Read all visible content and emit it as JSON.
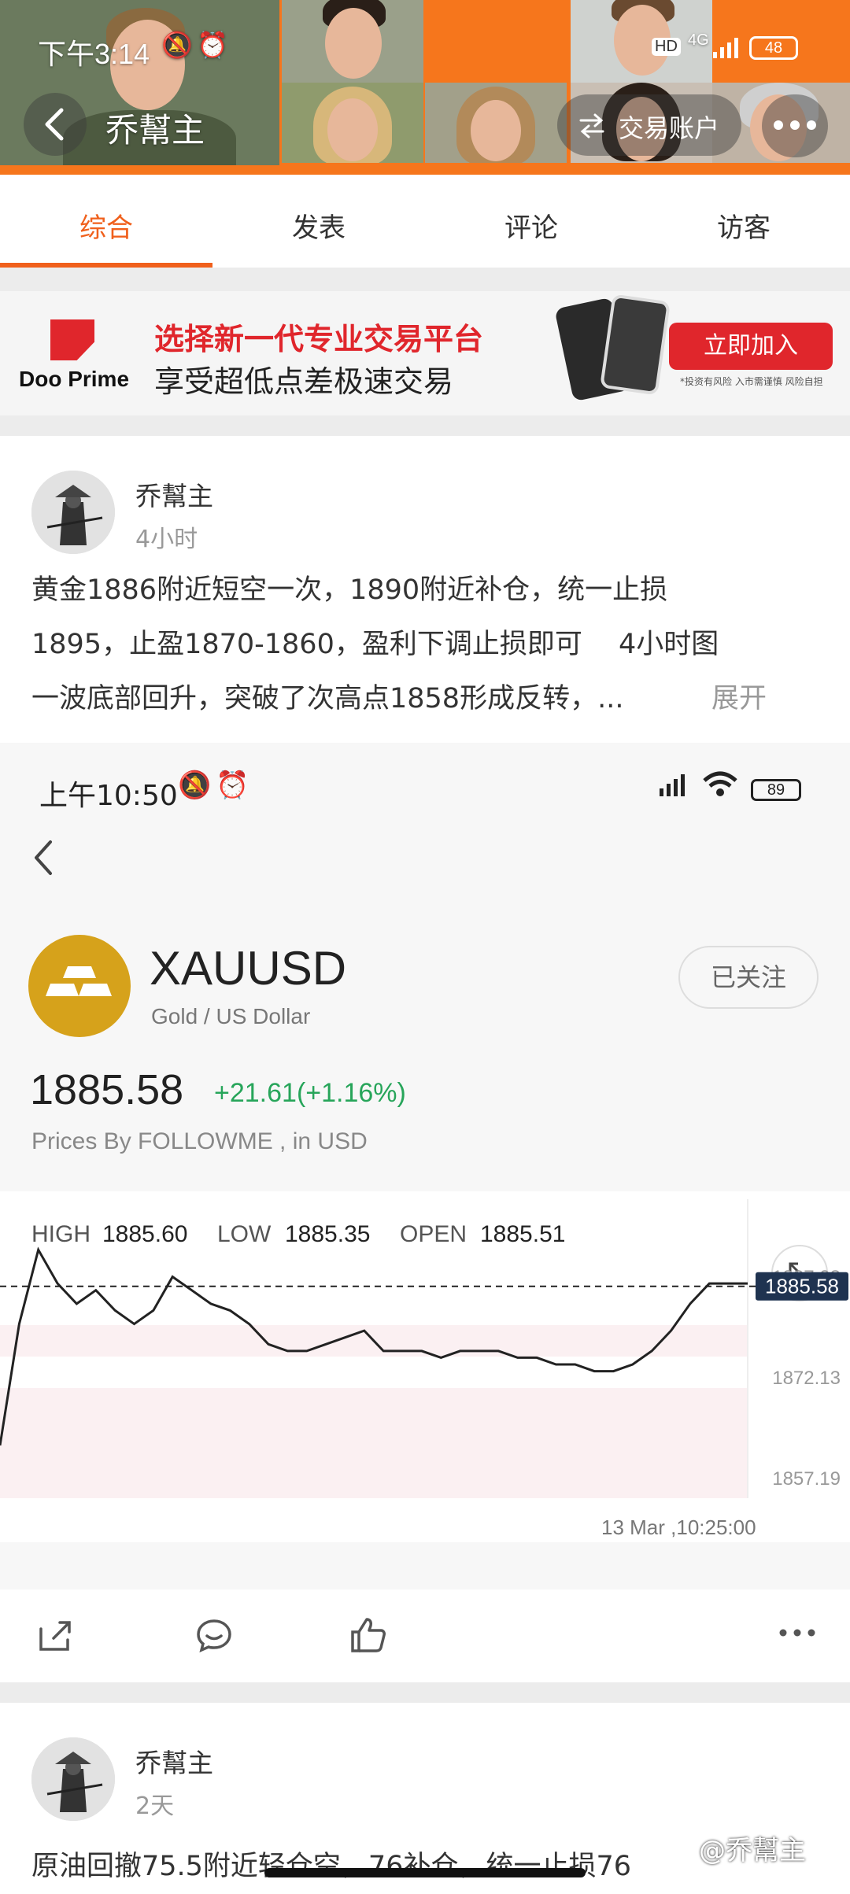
{
  "status_bar": {
    "time": "下午3:14",
    "hd": "HD",
    "network": "4G",
    "battery": "48"
  },
  "header": {
    "back_icon": "chevron-left-icon",
    "title": "乔幫主",
    "trade_account_label": "交易账户",
    "more_icon": "more-dots-icon"
  },
  "tabs": [
    {
      "label": "综合",
      "active": true
    },
    {
      "label": "发表",
      "active": false
    },
    {
      "label": "评论",
      "active": false
    },
    {
      "label": "访客",
      "active": false
    }
  ],
  "ad": {
    "brand": "Doo Prime",
    "headline": "选择新一代专业交易平台",
    "subline": "享受超低点差极速交易",
    "cta": "立即加入",
    "disclaimer": "*投资有风险 入市需谨慎 风险自担"
  },
  "post1": {
    "author": "乔幫主",
    "time": "4小时",
    "text_line1": "黄金1886附近短空一次，1890附近补仓，统一止损",
    "text_line2": "1895，止盈1870-1860，盈利下调止损即可　 4小时图",
    "text_line3": "一波底部回升，突破了次高点1858形成反转，...",
    "expand_label": "展开"
  },
  "embedded": {
    "status_time": "上午10:50",
    "battery": "89",
    "symbol": "XAUUSD",
    "symbol_name": "Gold / US Dollar",
    "follow_label": "已关注",
    "price": "1885.58",
    "change": "+21.61(+1.16%)",
    "source": "Prices By FOLLOWME , in USD",
    "high_label": "HIGH",
    "high_value": "1885.60",
    "low_label": "LOW",
    "low_value": "1885.35",
    "open_label": "OPEN",
    "open_value": "1885.51",
    "price_tag": "1885.58",
    "axis_labels": [
      "1887.08",
      "1872.13",
      "1857.19"
    ],
    "timestamp": "13 Mar ,10:25:00",
    "accent_green": "#27a55a",
    "gold_color": "#d6a21b"
  },
  "chart_data": {
    "type": "line",
    "title": "",
    "xlabel": "",
    "ylabel": "",
    "ylim": [
      1853,
      1895
    ],
    "yticks": [
      1887.08,
      1872.13,
      1857.19
    ],
    "current_value": 1885.58,
    "values": [
      1862,
      1880,
      1891,
      1886,
      1883,
      1885,
      1882,
      1880,
      1882,
      1887,
      1885,
      1883,
      1882,
      1880,
      1877,
      1876,
      1876,
      1877,
      1878,
      1879,
      1876,
      1876,
      1876,
      1875,
      1876,
      1876,
      1876,
      1875,
      1875,
      1874,
      1874,
      1873,
      1873,
      1874,
      1876,
      1879,
      1883,
      1886,
      1886,
      1886
    ]
  },
  "actions": {
    "share_icon": "share-icon",
    "comment_icon": "comment-icon",
    "like_icon": "thumbs-up-icon",
    "more_icon": "more-dots-icon"
  },
  "post2": {
    "author": "乔幫主",
    "time": "2天",
    "text_preview": "原油回撤75.5附近轻仓空，76补仓，统一止损76",
    "watermark": "@乔幫主"
  }
}
